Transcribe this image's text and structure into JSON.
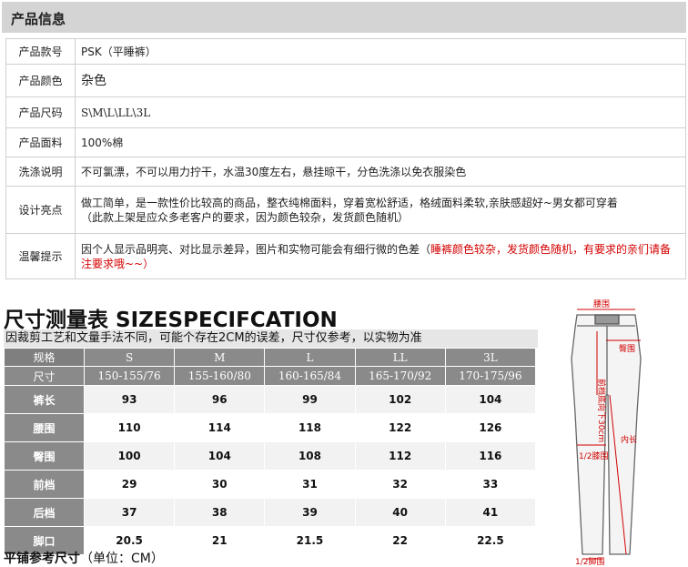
{
  "info": {
    "header": "产品信息",
    "rows": [
      {
        "label": "产品款号",
        "value": "PSK（平睡裤）"
      },
      {
        "label": "产品颜色",
        "value": "杂色"
      },
      {
        "label": "产品尺码",
        "value": " S\\M\\L\\LL\\3L"
      },
      {
        "label": "产品面料",
        "value": "100%棉"
      },
      {
        "label": "洗涤说明",
        "value": "不可氯漂，不可以用力拧干，水温30度左右，悬挂晾干，分色洗涤以免衣服染色"
      },
      {
        "label": "设计亮点",
        "value_line1": "做工简单，是一款性价比较高的商品，整衣纯棉面料，穿着宽松舒适，格绒面料柔软,亲肤感超好~男女都可穿着",
        "value_line2": "（此款上架是应众多老客户的要求，因为颜色较杂，发货颜色随机）"
      },
      {
        "label": "温馨提示",
        "value_black": "因个人显示品明亮、对比显示差异，图片和实物可能会有细行微的色差（",
        "value_red": "睡裤颜色较杂，发货颜色随机，有要求的亲们请备注要求哦~~）"
      }
    ]
  },
  "size": {
    "title": "尺寸测量表  SIZESPECIFCATION",
    "subtitle": "因裁剪工艺和文量手法不同，可能个存在2CM的误差，尺寸仅参考，以实物为准",
    "header_label": "规格",
    "sizes": [
      "S",
      "M",
      "L",
      "LL",
      "3L"
    ],
    "height_label": "尺寸",
    "heights": [
      "150-155/76",
      "155-160/80",
      "160-165/84",
      "165-170/92",
      "170-175/96"
    ],
    "rows": [
      {
        "label": "裤长",
        "values": [
          "93",
          "96",
          "99",
          "102",
          "104"
        ]
      },
      {
        "label": "腰围",
        "values": [
          "110",
          "114",
          "118",
          "122",
          "126"
        ]
      },
      {
        "label": "臀围",
        "values": [
          "100",
          "104",
          "108",
          "112",
          "116"
        ]
      },
      {
        "label": "前档",
        "values": [
          "29",
          "30",
          "31",
          "32",
          "33"
        ]
      },
      {
        "label": "后档",
        "values": [
          "37",
          "38",
          "39",
          "40",
          "41"
        ]
      },
      {
        "label": "脚口",
        "values": [
          "20.5",
          "21",
          "21.5",
          "22",
          "22.5"
        ]
      }
    ],
    "footer_bold": "平铺参考尺寸",
    "footer_normal": "（单位：CM）"
  },
  "diagram": {
    "waist": "腰围",
    "hip": "臀围",
    "front_rise": "前档底向下30cm",
    "half_hem": "1/2膝围",
    "inseam": "内长",
    "bottom": "1/2脚围"
  }
}
